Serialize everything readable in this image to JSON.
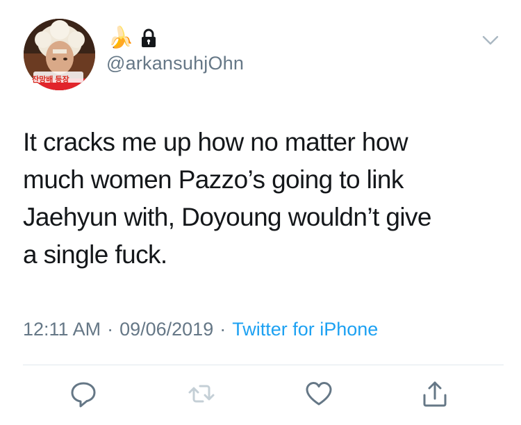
{
  "author": {
    "emoji": "🍌",
    "handle": "@arkansuhjOhn",
    "avatar_caption": "잔망배 등장"
  },
  "tweet": {
    "lines": [
      "It cracks me up how no matter how",
      "much women Pazzo’s going to link",
      "Jaehyun with, Doyoung wouldn’t give",
      "a single fuck."
    ]
  },
  "meta": {
    "time": "12:11 AM",
    "separator": "·",
    "date": "09/06/2019",
    "source": "Twitter for iPhone"
  },
  "icons": {
    "lock": "lock-icon",
    "more": "chevron-down-icon",
    "reply": "reply-icon",
    "retweet": "retweet-icon",
    "like": "heart-icon",
    "share": "share-icon"
  },
  "colors": {
    "text": "#14171a",
    "secondary": "#657786",
    "link": "#1da1f2",
    "divider": "#e1e8ed",
    "retweet_disabled": "#c4cfd6"
  }
}
